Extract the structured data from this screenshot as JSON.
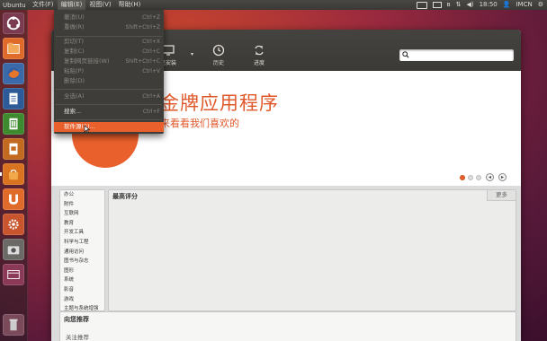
{
  "top_panel": {
    "app_name": "Ubuntu",
    "menus": [
      "文件(F)",
      "编辑(E)",
      "视图(V)",
      "帮助(H)"
    ],
    "time": "18:50",
    "user": "IMCN"
  },
  "edit_menu": {
    "items": [
      {
        "label": "撤消(U)",
        "shortcut": "Ctrl+Z",
        "disabled": true
      },
      {
        "label": "重做(R)",
        "shortcut": "Shift+Ctrl+Z",
        "disabled": true
      },
      {
        "label": "剪切(T)",
        "shortcut": "Ctrl+X",
        "disabled": true
      },
      {
        "label": "复制(C)",
        "shortcut": "Ctrl+C",
        "disabled": true
      },
      {
        "label": "复制网页链接(W)",
        "shortcut": "Shift+Ctrl+C",
        "disabled": true
      },
      {
        "label": "粘贴(P)",
        "shortcut": "Ctrl+V",
        "disabled": true
      },
      {
        "label": "删除(D)",
        "shortcut": "",
        "disabled": true
      },
      {
        "label": "全选(A)",
        "shortcut": "Ctrl+A",
        "disabled": true
      },
      {
        "label": "搜索...",
        "shortcut": "Ctrl+F",
        "disabled": false
      },
      {
        "label": "软件源(S)...",
        "shortcut": "",
        "disabled": false,
        "highlighted": true
      }
    ]
  },
  "toolbar": {
    "installed_label": "已安装",
    "history_label": "历史",
    "progress_label": "进度"
  },
  "banner": {
    "title": "金牌应用程序",
    "subtitle": "来看看我们喜欢的"
  },
  "categories": [
    "办公",
    "附件",
    "互联网",
    "教育",
    "开发工具",
    "科学与工程",
    "通用访问",
    "图书与杂志",
    "图形",
    "系统",
    "影音",
    "游戏",
    "主题与系统增强",
    "字体"
  ],
  "top_rated": {
    "header": "最高评分",
    "more_label": "更多"
  },
  "recommend": {
    "header": "向您推荐",
    "sub": "关注推荐"
  },
  "colors": {
    "accent": "#e9602c",
    "panel": "#3e3d39"
  }
}
